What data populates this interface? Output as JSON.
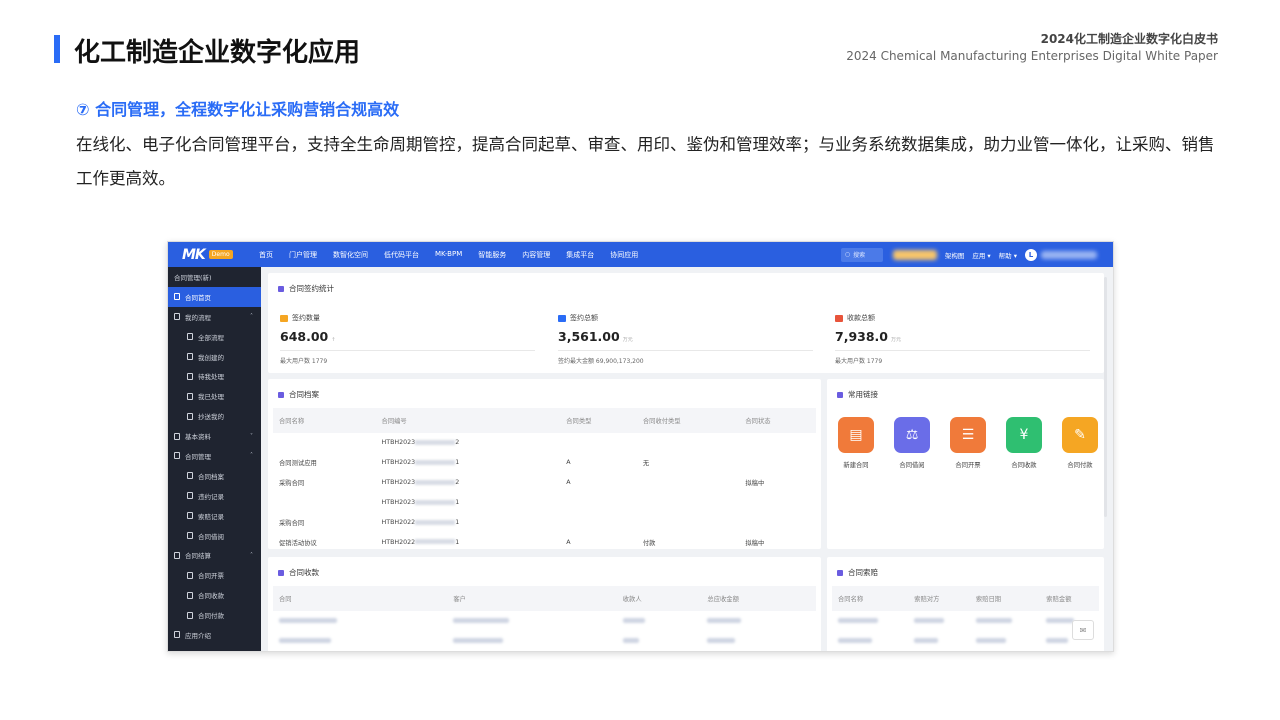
{
  "slide": {
    "title": "化工制造企业数字化应用",
    "header_line1": "2024化工制造企业数字化白皮书",
    "header_line2": "2024 Chemical Manufacturing Enterprises Digital White Paper",
    "section_title": "⑦ 合同管理，全程数字化让采购营销合规高效",
    "section_body": "在线化、电子化合同管理平台，支持全生命周期管控，提高合同起草、审查、用印、鉴伪和管理效率；与业务系统数据集成，助力业管一体化，让采购、销售工作更高效。"
  },
  "app": {
    "logo": "MK",
    "logo_badge": "Demo",
    "nav": [
      "首页",
      "门户管理",
      "数智化空间",
      "低代码平台",
      "MK-BPM",
      "智能服务",
      "内容管理",
      "集成平台",
      "协同应用"
    ],
    "search_placeholder": "搜索",
    "topbar_right": [
      "架构图",
      "应用",
      "帮助"
    ],
    "avatar_letter": "L",
    "sidebar": [
      {
        "label": "合同管理(新)",
        "level": 0,
        "icon": "none",
        "caret": ""
      },
      {
        "label": "合同首页",
        "level": 0,
        "icon": "doc-icon",
        "caret": "",
        "active": true
      },
      {
        "label": "我的流程",
        "level": 0,
        "icon": "folder-icon",
        "caret": "⌃"
      },
      {
        "label": "全部流程",
        "level": 1,
        "icon": "doc-icon",
        "caret": ""
      },
      {
        "label": "我创建的",
        "level": 1,
        "icon": "doc-icon",
        "caret": ""
      },
      {
        "label": "待我处理",
        "level": 1,
        "icon": "doc-icon",
        "caret": ""
      },
      {
        "label": "我已处理",
        "level": 1,
        "icon": "doc-icon",
        "caret": ""
      },
      {
        "label": "抄送我的",
        "level": 1,
        "icon": "doc-icon",
        "caret": ""
      },
      {
        "label": "基本资料",
        "level": 0,
        "icon": "folder-icon",
        "caret": "⌄"
      },
      {
        "label": "合同管理",
        "level": 0,
        "icon": "folder-icon",
        "caret": "⌃"
      },
      {
        "label": "合同档案",
        "level": 1,
        "icon": "doc-icon",
        "caret": ""
      },
      {
        "label": "违约记录",
        "level": 1,
        "icon": "doc-icon",
        "caret": ""
      },
      {
        "label": "索赔记录",
        "level": 1,
        "icon": "doc-icon",
        "caret": ""
      },
      {
        "label": "合同借阅",
        "level": 1,
        "icon": "doc-icon",
        "caret": ""
      },
      {
        "label": "合同结算",
        "level": 0,
        "icon": "folder-icon",
        "caret": "⌃"
      },
      {
        "label": "合同开票",
        "level": 1,
        "icon": "doc-icon",
        "caret": ""
      },
      {
        "label": "合同收款",
        "level": 1,
        "icon": "doc-icon",
        "caret": ""
      },
      {
        "label": "合同付款",
        "level": 1,
        "icon": "doc-icon",
        "caret": ""
      },
      {
        "label": "应用介绍",
        "level": 0,
        "icon": "doc-icon",
        "caret": ""
      }
    ],
    "stats": {
      "title": "合同签约统计",
      "items": [
        {
          "label": "签约数量",
          "value": "648.00",
          "unit": "↑",
          "note": "最大用户数 1779",
          "color": "#f5a623"
        },
        {
          "label": "签约总额",
          "value": "3,561.00",
          "unit": "万元",
          "note": "签约最大金额 69,900,173,200",
          "color": "#2a6cf6"
        },
        {
          "label": "收款总额",
          "value": "7,938.0",
          "unit": "万元",
          "note": "最大用户数 1779",
          "color": "#e8543b"
        }
      ]
    },
    "archive": {
      "title": "合同档案",
      "columns": [
        "合同名称",
        "合同编号",
        "合同类型",
        "合同收付类型",
        "合同状态"
      ],
      "rows": [
        [
          "",
          "HTBH2023",
          "2",
          "",
          "",
          ""
        ],
        [
          "合同测试应用",
          "HTBH2023",
          "1",
          "A",
          "无",
          ""
        ],
        [
          "采购合同",
          "HTBH2023",
          "2",
          "A",
          "",
          "拟稿中"
        ],
        [
          "",
          "HTBH2023",
          "1",
          "",
          "",
          ""
        ],
        [
          "采购合同",
          "HTBH2022",
          "1",
          "",
          "",
          ""
        ],
        [
          "促销活动协议",
          "HTBH2022",
          "1",
          "A",
          "付款",
          "拟稿中"
        ]
      ]
    },
    "links": {
      "title": "常用链接",
      "items": [
        {
          "label": "新建合同",
          "icon": "new-contract-icon",
          "color": "#f07a3a"
        },
        {
          "label": "合同借阅",
          "icon": "balance-icon",
          "color": "#6a6de8"
        },
        {
          "label": "合同开票",
          "icon": "invoice-icon",
          "color": "#f07a3a"
        },
        {
          "label": "合同收款",
          "icon": "yuan-icon",
          "color": "#2fbf71"
        },
        {
          "label": "合同付款",
          "icon": "payment-icon",
          "color": "#f5a623"
        }
      ]
    },
    "receipts": {
      "title": "合同收款",
      "columns": [
        "合同",
        "客户",
        "收款人",
        "总应收金额"
      ]
    },
    "claims": {
      "title": "合同索赔",
      "columns": [
        "合同名称",
        "索赔对方",
        "索赔日期",
        "索赔金额"
      ]
    }
  }
}
